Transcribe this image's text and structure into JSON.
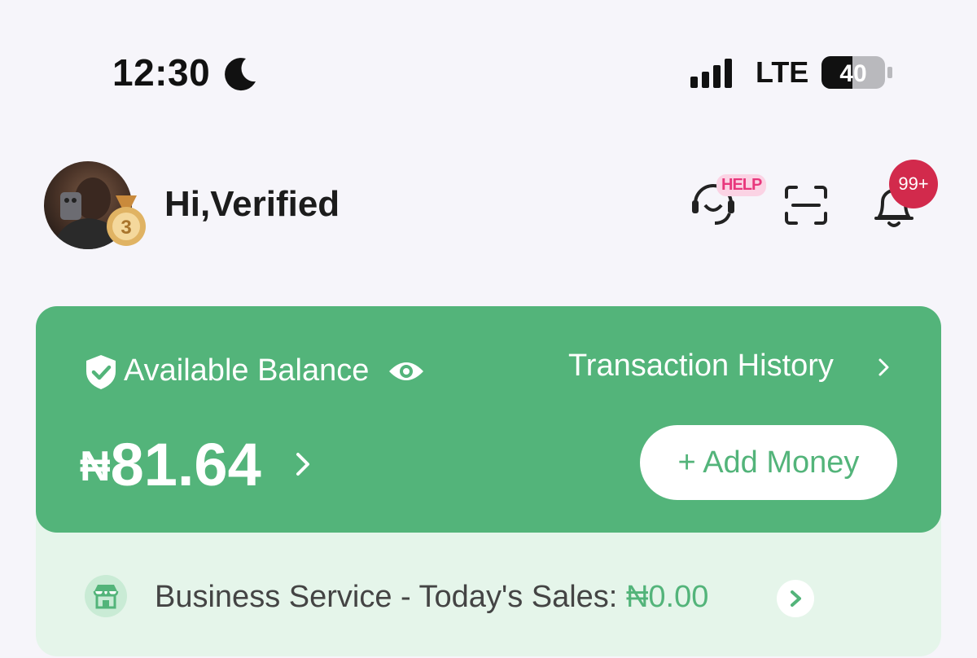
{
  "status_bar": {
    "time": "12:30",
    "network": "LTE",
    "battery": "40",
    "icons": [
      "moon-icon",
      "signal-icon",
      "battery-icon"
    ]
  },
  "header": {
    "greeting": "Hi,Verified",
    "medal_level": "3",
    "help_badge": "HELP",
    "notification_count": "99+",
    "icons": [
      "support-headset-icon",
      "scan-icon",
      "bell-icon"
    ]
  },
  "balance_card": {
    "label": "Available Balance",
    "transaction_history": "Transaction History",
    "currency": "₦",
    "amount": "81.64",
    "add_money": "+ Add Money",
    "icons": [
      "shield-check-icon",
      "eye-icon",
      "chevron-right-icon"
    ]
  },
  "business": {
    "text": "Business Service - Today's Sales: ",
    "amount": "₦0.00",
    "icons": [
      "store-icon",
      "chevron-right-icon"
    ]
  },
  "colors": {
    "accent_green": "#53b47a",
    "light_green": "#e5f5ea",
    "badge_red": "#d22a4c",
    "help_pink": "#e8377c",
    "background": "#f6f5fa"
  }
}
